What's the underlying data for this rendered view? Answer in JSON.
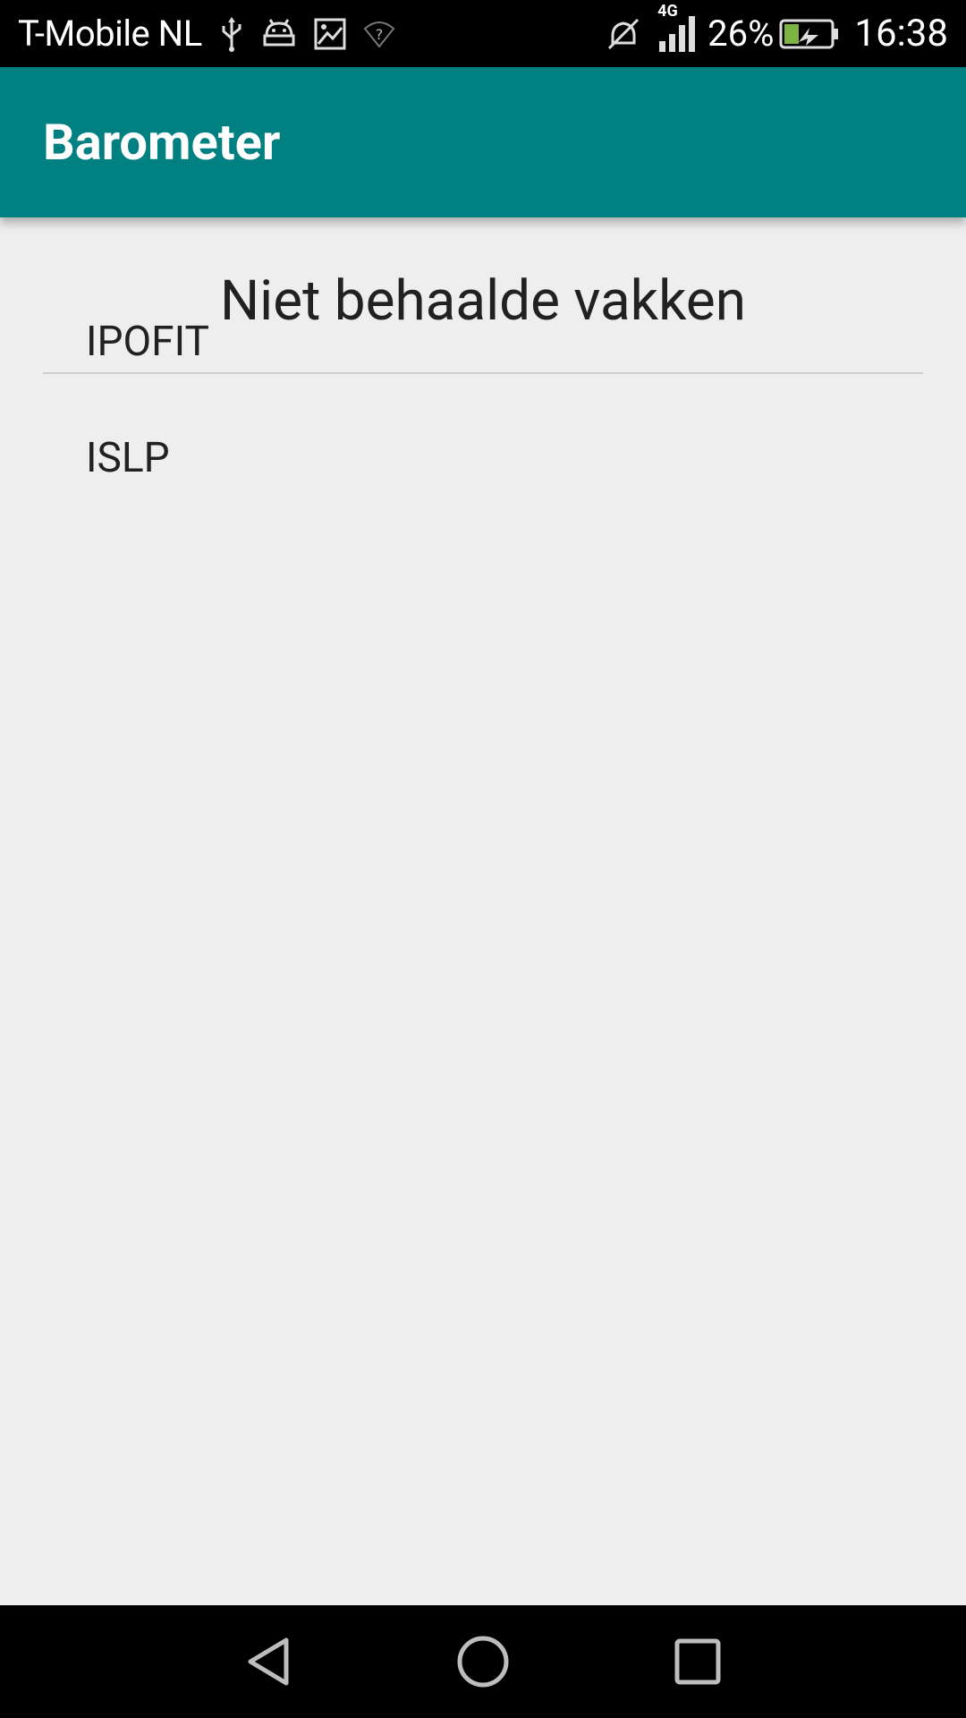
{
  "status_bar": {
    "carrier": "T-Mobile  NL",
    "network_type": "4G",
    "battery": "26%",
    "time": "16:38",
    "icons": [
      "usb-icon",
      "android-debug-icon",
      "screenshot-icon",
      "wifi-unknown-icon",
      "mute-icon",
      "signal-icon",
      "battery-charging-icon"
    ]
  },
  "app_bar": {
    "title": "Barometer",
    "background_color": "#008080"
  },
  "main": {
    "section_title": "Niet behaalde vakken",
    "items": [
      {
        "label": "IPOFIT"
      },
      {
        "label": "ISLP"
      }
    ]
  },
  "nav_bar": {
    "buttons": [
      "back-icon",
      "home-icon",
      "recents-icon"
    ]
  }
}
